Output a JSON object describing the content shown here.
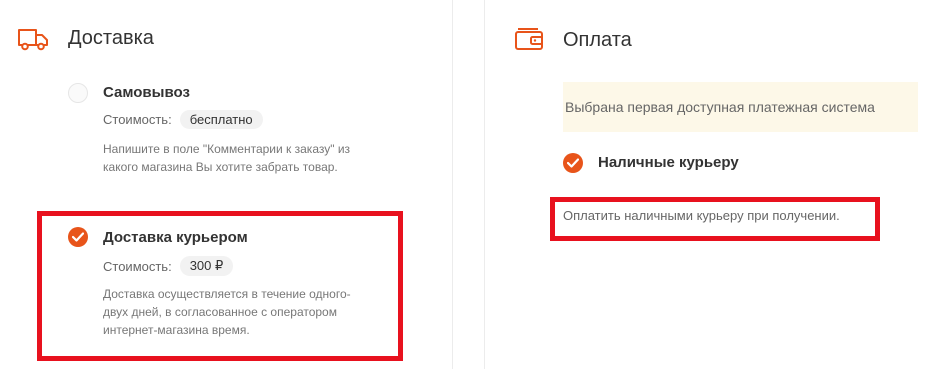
{
  "delivery": {
    "title": "Доставка",
    "options": [
      {
        "name": "Самовывоз",
        "cost_label": "Стоимость:",
        "cost": "бесплатно",
        "description": "Напишите в поле \"Комментарии к заказу\" из какого магазина Вы хотите забрать товар.",
        "selected": false
      },
      {
        "name": "Доставка курьером",
        "cost_label": "Стоимость:",
        "cost": "300 ₽",
        "description": "Доставка осуществляется в течение одного-двух дней, в согласованное с оператором интернет-магазина время.",
        "selected": true
      }
    ]
  },
  "payment": {
    "title": "Оплата",
    "notice": "Выбрана первая доступная платежная система",
    "option": {
      "name": "Наличные курьеру",
      "selected": true
    },
    "description": "Оплатить наличными курьеру при получении."
  },
  "colors": {
    "accent": "#e8541a",
    "highlight_box": "#e8111e",
    "notice_bg": "#fdf8e8"
  },
  "icons": {
    "delivery": "truck-icon",
    "payment": "wallet-icon",
    "selected": "checkmark-icon"
  }
}
